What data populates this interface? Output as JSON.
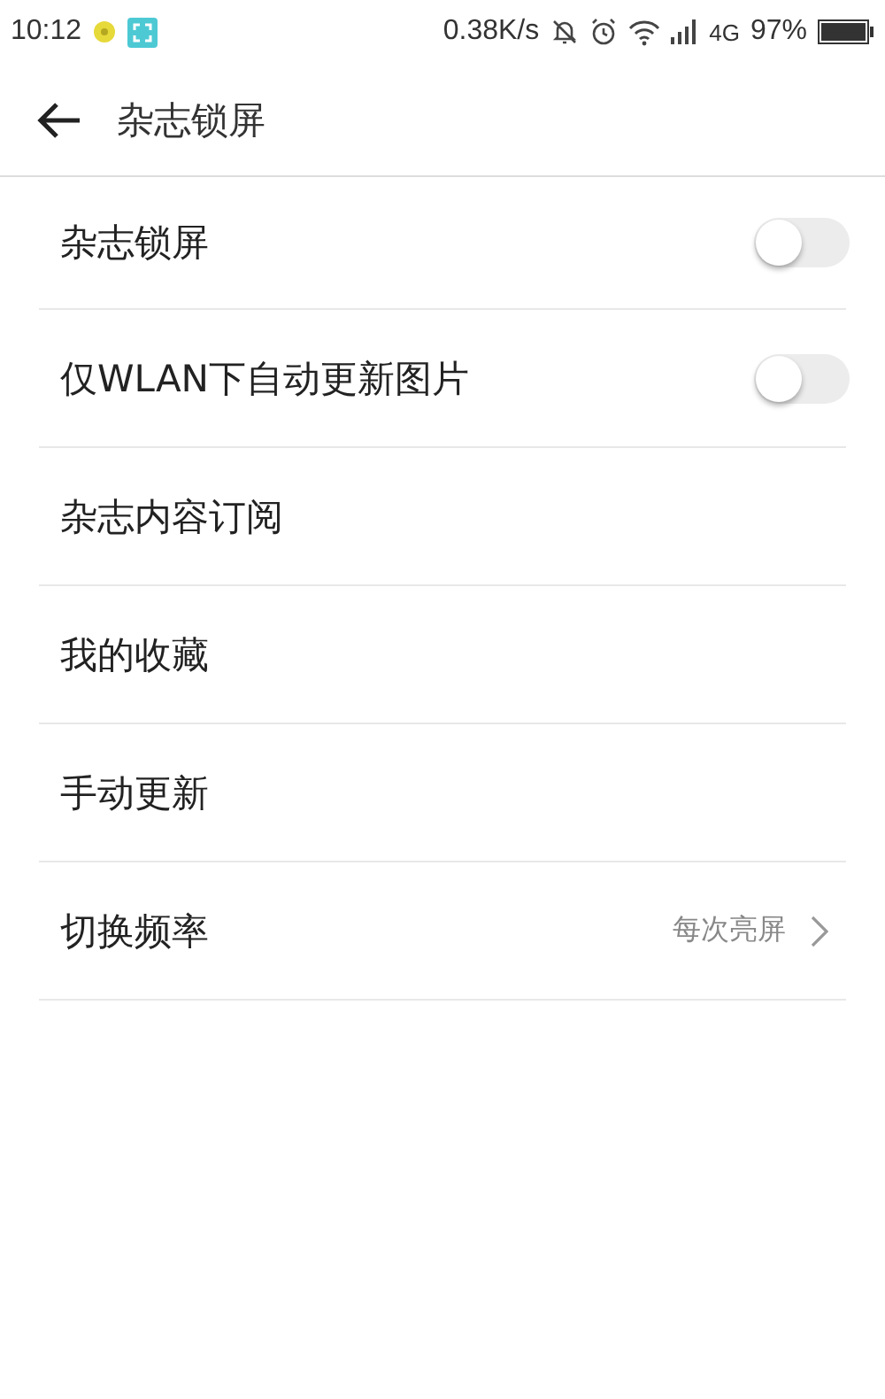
{
  "status_bar": {
    "time": "10:12",
    "speed": "0.38K/s",
    "network": "4G",
    "battery": "97%"
  },
  "header": {
    "title": "杂志锁屏"
  },
  "settings": [
    {
      "kind": "toggle",
      "label": "杂志锁屏",
      "on": false
    },
    {
      "kind": "toggle",
      "label": "仅WLAN下自动更新图片",
      "on": false
    },
    {
      "kind": "link",
      "label": "杂志内容订阅"
    },
    {
      "kind": "link",
      "label": "我的收藏"
    },
    {
      "kind": "link",
      "label": "手动更新"
    },
    {
      "kind": "value",
      "label": "切换频率",
      "value": "每次亮屏"
    }
  ]
}
